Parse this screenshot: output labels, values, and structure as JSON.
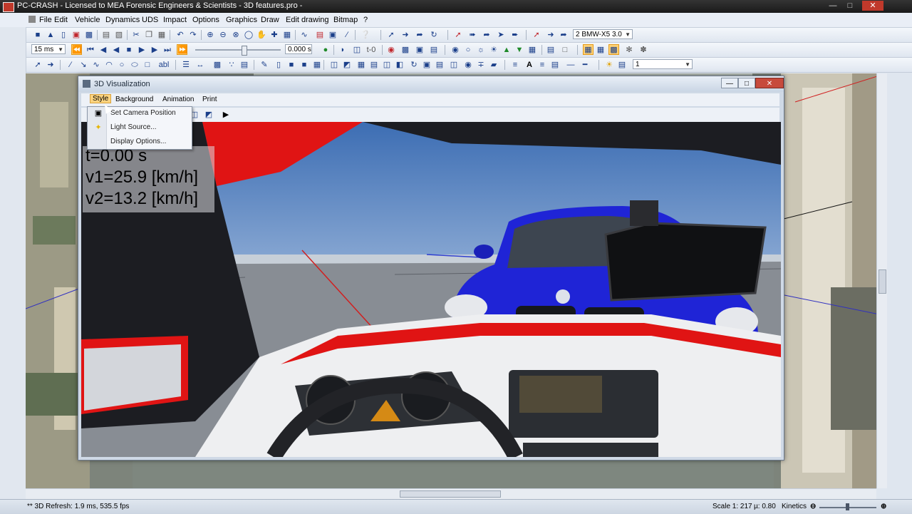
{
  "app": {
    "title": "PC-CRASH - Licensed to MEA Forensic Engineers & Scientists - 3D features.pro -",
    "window_controls": [
      "minimize",
      "maximize",
      "close"
    ]
  },
  "menubar": {
    "items": [
      "File",
      "Edit",
      "Vehicle",
      "Dynamics",
      "UDS",
      "Impact",
      "Options",
      "Graphics",
      "Draw",
      "Edit drawing",
      "Bitmap",
      "?"
    ]
  },
  "toolbar": {
    "vehicle_select": "2  BMW-X5 3.0",
    "time_step": "15 ms",
    "time_value": "0.000 s",
    "layer_select": "1",
    "t0_label": "t-0"
  },
  "win3d": {
    "title": "3D Visualization",
    "menu": [
      "Style",
      "Background",
      "Animation",
      "Print"
    ],
    "active_menu": "Style"
  },
  "dropdown": {
    "items": [
      {
        "label": "Set Camera Position",
        "icon": "camera-icon"
      },
      {
        "label": "Light Source...",
        "icon": "light-icon"
      },
      {
        "label": "Display Options...",
        "icon": ""
      }
    ]
  },
  "telemetry": {
    "time": "t=0.00 s",
    "v1": "v1=25.9 [km/h]",
    "v2": "v2=13.2 [km/h]"
  },
  "status": {
    "refresh": "** 3D Refresh: 1.9 ms, 535.5 fps",
    "scale": "Scale 1: 217",
    "mu": "µ: 0.80",
    "mode": "Kinetics"
  },
  "colors": {
    "car_blue": "#1f24d6",
    "car_red": "#e01414",
    "sky_top": "#4d78b8",
    "ground": "#8a9099"
  }
}
